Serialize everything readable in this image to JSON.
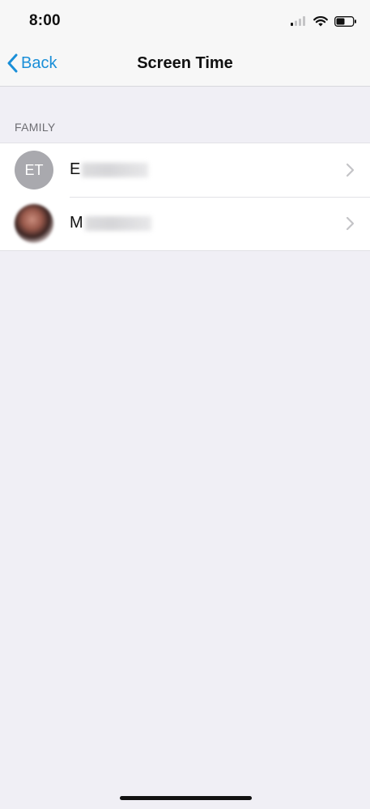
{
  "status_bar": {
    "time": "8:00",
    "icons": [
      "cellular-signal-icon",
      "wifi-icon",
      "battery-icon"
    ]
  },
  "nav": {
    "back_label": "Back",
    "title": "Screen Time",
    "accent_color": "#1a8fd8"
  },
  "family": {
    "header": "FAMILY",
    "members": [
      {
        "initials": "ET",
        "name_prefix": "E",
        "avatar_type": "initials"
      },
      {
        "initials": "",
        "name_prefix": "M",
        "avatar_type": "photo"
      }
    ]
  }
}
